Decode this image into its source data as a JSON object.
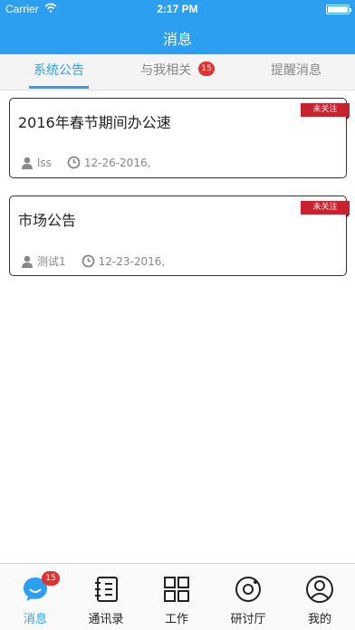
{
  "status_bar": {
    "carrier": "Carrier",
    "time": "2:17 PM",
    "battery_level": 1.0
  },
  "nav": {
    "title": "消息"
  },
  "tabs": [
    {
      "label": "系统公告",
      "active": true,
      "badge": ""
    },
    {
      "label": "与我相关",
      "active": false,
      "badge": "15"
    },
    {
      "label": "提醒消息",
      "active": false,
      "badge": ""
    }
  ],
  "messages": [
    {
      "title": "2016年春节期间办公速",
      "ribbon": "未关注",
      "author": "lss",
      "date": "12-26-2016,"
    },
    {
      "title": "市场公告",
      "ribbon": "未关注",
      "author": "测试1",
      "date": "12-23-2016,"
    }
  ],
  "bottom_tabs": [
    {
      "label": "消息",
      "icon": "chat-bubble-icon",
      "active": true,
      "badge": "15"
    },
    {
      "label": "通讯录",
      "icon": "contacts-book-icon",
      "active": false
    },
    {
      "label": "工作",
      "icon": "grid-icon",
      "active": false
    },
    {
      "label": "研讨厅",
      "icon": "disc-icon",
      "active": false
    },
    {
      "label": "我的",
      "icon": "profile-icon",
      "active": false
    }
  ],
  "colors": {
    "primary": "#2d9ff0",
    "badge": "#e23131",
    "ribbon": "#c8222e"
  }
}
